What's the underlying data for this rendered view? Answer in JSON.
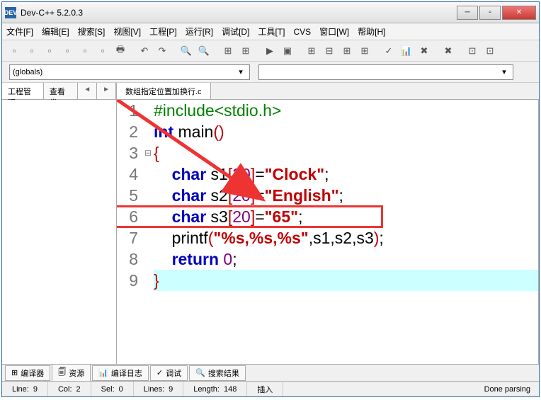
{
  "window": {
    "title": "Dev-C++ 5.2.0.3",
    "icon_text": "DEV"
  },
  "menu": [
    "文件[F]",
    "编辑[E]",
    "搜索[S]",
    "视图[V]",
    "工程[P]",
    "运行[R]",
    "调试[D]",
    "工具[T]",
    "CVS",
    "窗口[W]",
    "帮助[H]"
  ],
  "combo": {
    "scope": "(globals)",
    "symbol": ""
  },
  "left_panel": {
    "tabs": [
      "工程管理",
      "查看类"
    ],
    "nav": [
      "◄",
      "►"
    ]
  },
  "file_tab": "数组指定位置加换行.c",
  "code": {
    "lines": [
      1,
      2,
      3,
      4,
      5,
      6,
      7,
      8,
      9
    ],
    "fold": [
      "",
      "",
      "⊟",
      "",
      "",
      "",
      "",
      "",
      ""
    ],
    "tokens": [
      [
        {
          "t": "#include<stdio.h>",
          "c": "pp"
        }
      ],
      [
        {
          "t": "int ",
          "c": "type"
        },
        {
          "t": "main",
          "c": "fn"
        },
        {
          "t": "()",
          "c": "brk"
        }
      ],
      [
        {
          "t": "{",
          "c": "brk"
        }
      ],
      [
        {
          "t": "    "
        },
        {
          "t": "char ",
          "c": "type"
        },
        {
          "t": "s1",
          "c": "fn"
        },
        {
          "t": "[",
          "c": "brk"
        },
        {
          "t": "20",
          "c": "num"
        },
        {
          "t": "]",
          "c": "brk"
        },
        {
          "t": "=",
          "c": "pct"
        },
        {
          "t": "\"Clock\"",
          "c": "str"
        },
        {
          "t": ";",
          "c": "pct"
        }
      ],
      [
        {
          "t": "    "
        },
        {
          "t": "char ",
          "c": "type"
        },
        {
          "t": "s2",
          "c": "fn"
        },
        {
          "t": "[",
          "c": "brk"
        },
        {
          "t": "20",
          "c": "num"
        },
        {
          "t": "]",
          "c": "brk"
        },
        {
          "t": "=",
          "c": "pct"
        },
        {
          "t": "\"English\"",
          "c": "str"
        },
        {
          "t": ";",
          "c": "pct"
        }
      ],
      [
        {
          "t": "    "
        },
        {
          "t": "char ",
          "c": "type"
        },
        {
          "t": "s3",
          "c": "fn"
        },
        {
          "t": "[",
          "c": "brk"
        },
        {
          "t": "20",
          "c": "num"
        },
        {
          "t": "]",
          "c": "brk"
        },
        {
          "t": "=",
          "c": "pct"
        },
        {
          "t": "\"65\"",
          "c": "str"
        },
        {
          "t": ";",
          "c": "pct"
        }
      ],
      [
        {
          "t": "    "
        },
        {
          "t": "printf",
          "c": "fn"
        },
        {
          "t": "(",
          "c": "brk"
        },
        {
          "t": "\"%s,%s,%s\"",
          "c": "str"
        },
        {
          "t": ",s1,s2,s3",
          "c": "pct"
        },
        {
          "t": ")",
          "c": "brk"
        },
        {
          "t": ";",
          "c": "pct"
        }
      ],
      [
        {
          "t": "    "
        },
        {
          "t": "return ",
          "c": "type"
        },
        {
          "t": "0",
          "c": "num"
        },
        {
          "t": ";",
          "c": "pct"
        }
      ],
      [
        {
          "t": "}",
          "c": "brk"
        }
      ]
    ],
    "current_line_index": 8
  },
  "bottom_tabs": [
    {
      "icon": "⊞",
      "label": "编译器"
    },
    {
      "icon": "🗐",
      "label": "资源"
    },
    {
      "icon": "📊",
      "label": "编译日志"
    },
    {
      "icon": "✓",
      "label": "调试"
    },
    {
      "icon": "🔍",
      "label": "搜索结果"
    }
  ],
  "status": {
    "line_label": "Line:",
    "line": "9",
    "col_label": "Col:",
    "col": "2",
    "sel_label": "Sel:",
    "sel": "0",
    "lines_label": "Lines:",
    "lines": "9",
    "length_label": "Length:",
    "length": "148",
    "mode": "插入",
    "parse": "Done parsing"
  },
  "toolbar_icons": [
    "▫",
    "▫",
    "▫",
    "▫",
    "▫",
    "▫",
    "🖶",
    "",
    "↶",
    "↷",
    "",
    "🔍",
    "🔍",
    "",
    "⊞",
    "⊞",
    "",
    "▶",
    "▣",
    "",
    "⊞",
    "⊟",
    "⊞",
    "⊞",
    "",
    "✓",
    "📊",
    "✖",
    "",
    "✖",
    "",
    "⊡",
    "⊡"
  ],
  "watermark": ""
}
